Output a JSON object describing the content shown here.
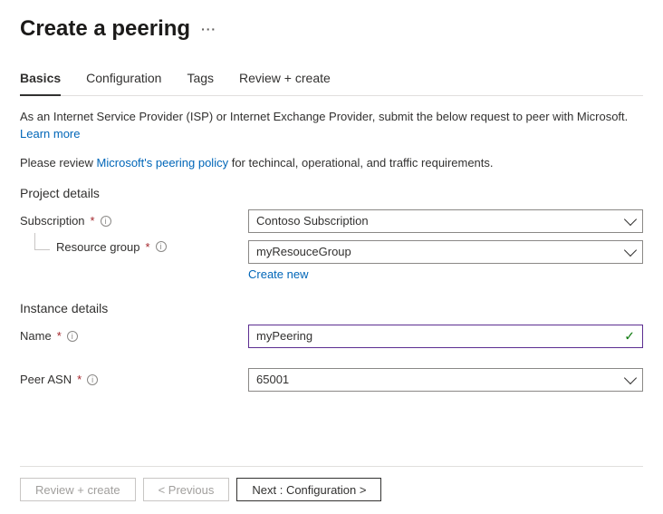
{
  "header": {
    "title": "Create a peering"
  },
  "tabs": [
    {
      "label": "Basics",
      "active": true
    },
    {
      "label": "Configuration",
      "active": false
    },
    {
      "label": "Tags",
      "active": false
    },
    {
      "label": "Review + create",
      "active": false
    }
  ],
  "intro": {
    "text": "As an Internet Service Provider (ISP) or Internet Exchange Provider, submit the below request to peer with Microsoft.",
    "learn_more": "Learn more"
  },
  "policy": {
    "prefix": "Please review ",
    "link": "Microsoft's peering policy",
    "suffix": " for techincal, operational, and traffic requirements."
  },
  "project": {
    "title": "Project details",
    "subscription_label": "Subscription",
    "subscription_value": "Contoso Subscription",
    "rg_label": "Resource group",
    "rg_value": "myResouceGroup",
    "create_new": "Create new"
  },
  "instance": {
    "title": "Instance details",
    "name_label": "Name",
    "name_value": "myPeering",
    "asn_label": "Peer ASN",
    "asn_value": "65001"
  },
  "footer": {
    "review": "Review + create",
    "previous": "< Previous",
    "next": "Next : Configuration >"
  }
}
